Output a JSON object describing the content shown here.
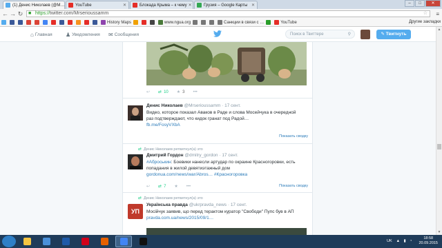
{
  "tabs": [
    {
      "label": "(1) Денис Николаев (@M…",
      "color": "#55acee",
      "active": true
    },
    {
      "label": "YouTube",
      "color": "#e52d27",
      "active": false
    },
    {
      "label": "Блокада Крыма – к чему",
      "color": "#e52d27",
      "active": false
    },
    {
      "label": "Грузия – Google Карты",
      "color": "#34a853",
      "active": false
    }
  ],
  "window": {
    "minimize": "–",
    "maximize": "□",
    "close": "✕"
  },
  "toolbar": {
    "back_icon": "back-arrow-icon",
    "forward_icon": "forward-arrow-icon",
    "reload_icon": "reload-icon",
    "url_scheme": "https://",
    "url_rest": "twitter.com/Mrserioussamm"
  },
  "bookmarks": [
    {
      "label": "",
      "color": "#55acee"
    },
    {
      "label": "",
      "color": "#3b5998"
    },
    {
      "label": "",
      "color": "#3b5998"
    },
    {
      "label": "",
      "color": "#db4437"
    },
    {
      "label": "",
      "color": "#db4437"
    },
    {
      "label": "",
      "color": "#4285f4"
    },
    {
      "label": "",
      "color": "#e52d27"
    },
    {
      "label": "",
      "color": "#3b5998"
    },
    {
      "label": "",
      "color": "#e52d27"
    },
    {
      "label": "",
      "color": "#f7931e"
    },
    {
      "label": "",
      "color": "#e52d27"
    },
    {
      "label": "",
      "color": "#3b5998"
    },
    {
      "label": "History Maps",
      "color": "#8e44ad"
    },
    {
      "label": "",
      "color": "#f0a000"
    },
    {
      "label": "",
      "color": "#e52d27"
    },
    {
      "label": "",
      "color": "#444444"
    },
    {
      "label": "www.ngua.org",
      "color": "#4a7a3a"
    },
    {
      "label": "",
      "color": "#777777"
    },
    {
      "label": "",
      "color": "#777777"
    },
    {
      "label": "",
      "color": "#777777"
    },
    {
      "label": "Санкции в связи с …",
      "color": "#777777"
    },
    {
      "label": "",
      "color": "#2a9d2a"
    },
    {
      "label": "YouTube",
      "color": "#e52d27"
    }
  ],
  "bookmarks_other": "Другие закладки",
  "twitter_nav": {
    "home": "Главная",
    "notifications": "Уведомления",
    "messages": "Сообщения",
    "search_placeholder": "Поиск в Твиттере",
    "tweet_button": "Твитнуть"
  },
  "tweets": [
    {
      "kind": "media-top",
      "retweets": "10",
      "favorites": "3"
    },
    {
      "name": "Денис Николаев",
      "handle": "@Mrserioussamm",
      "time": "· 17 сент.",
      "text": "Видео, которое показал Аваков в Раде и слова Мосейчука в очередной раз подтверждают, что кидок гранат под Радой…",
      "link": "fb.me/FosyVXbA",
      "summary": "Показать сводку"
    },
    {
      "retweeted_by": "Денис Николаев ретвитнул(а) это",
      "name": "Дмитрий Гордон",
      "handle": "@dmitry_gordon",
      "time": "· 17 сент.",
      "hashtag": "#Аброськин",
      "text": ": Боевики нанесли артудар по окраине Красногоровки, есть попадания в жилой девятиэтажный дом",
      "link": "gordonua.com/news/war/Abros…",
      "hashtag2": "#Красногоровка",
      "retweets": "7",
      "summary": "Показать сводку"
    },
    {
      "retweeted_by": "Денис Николаев ретвитнул(а) это",
      "name": "Українська правда",
      "handle": "@ukrpravda_news",
      "time": "· 17 сент.",
      "text": "Мосійчук заявив, що перед терактом куратор \"Свободи\" Пупс був в АП",
      "link": "pravda.com.ua/news/2015/09/1…",
      "avatar_text": "УП"
    }
  ],
  "taskbar": {
    "apps": [
      {
        "color": "#f5c542"
      },
      {
        "color": "#4a90d9"
      },
      {
        "color": "#1e5aa8"
      },
      {
        "color": "#d0021b"
      },
      {
        "color": "#e66000"
      },
      {
        "color": "#4285f4",
        "active": true
      },
      {
        "color": "#111111"
      }
    ],
    "lang": "UK",
    "time": "18:58",
    "date": "20.09.2015"
  }
}
